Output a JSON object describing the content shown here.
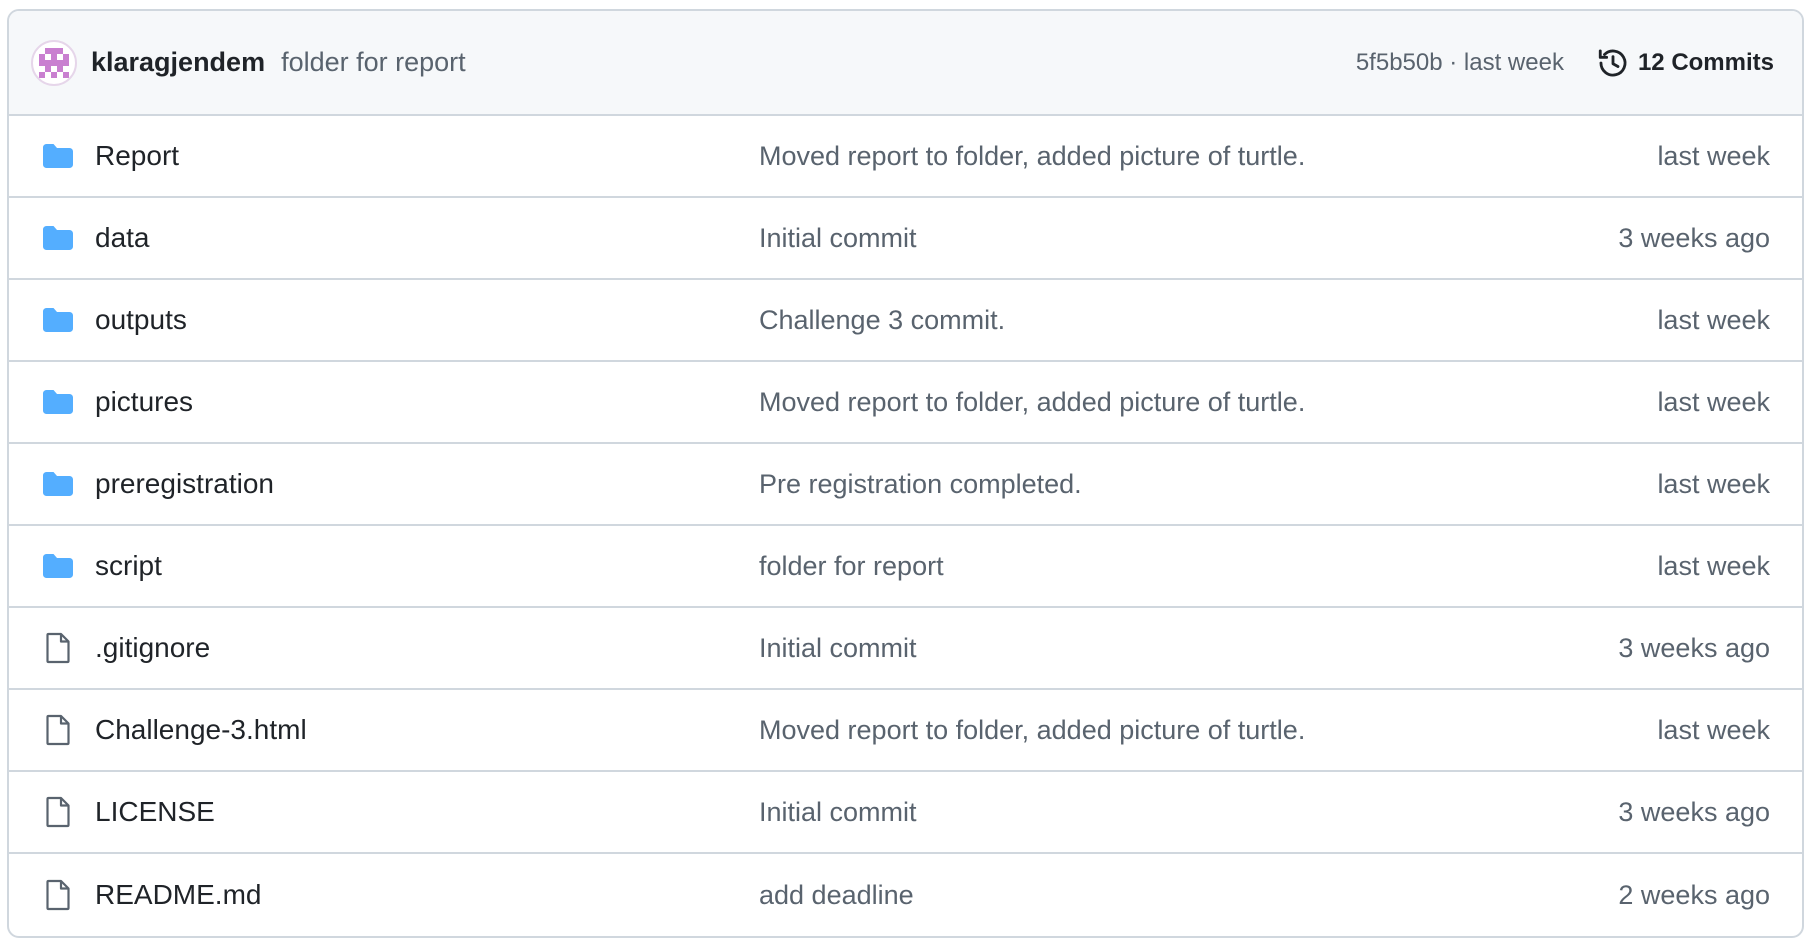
{
  "colors": {
    "folder": "#54aeff",
    "file_outline": "#59636e",
    "border": "#d0d7de",
    "header_bg": "#f6f8fa",
    "avatar_pink": "#c97fd0"
  },
  "latest_commit": {
    "author": "klaragjendem",
    "message": "folder for report",
    "meta": "5f5b50b · last week",
    "commits_label": "12 Commits",
    "avatar_icon": "identicon-avatar",
    "history_icon": "history-icon"
  },
  "files": [
    {
      "icon": "folder-icon",
      "name": "Report",
      "message": "Moved report to folder, added picture of turtle.",
      "date": "last week"
    },
    {
      "icon": "folder-icon",
      "name": "data",
      "message": "Initial commit",
      "date": "3 weeks ago"
    },
    {
      "icon": "folder-icon",
      "name": "outputs",
      "message": "Challenge 3 commit.",
      "date": "last week"
    },
    {
      "icon": "folder-icon",
      "name": "pictures",
      "message": "Moved report to folder, added picture of turtle.",
      "date": "last week"
    },
    {
      "icon": "folder-icon",
      "name": "preregistration",
      "message": "Pre registration completed.",
      "date": "last week"
    },
    {
      "icon": "folder-icon",
      "name": "script",
      "message": "folder for report",
      "date": "last week"
    },
    {
      "icon": "file-icon",
      "name": ".gitignore",
      "message": "Initial commit",
      "date": "3 weeks ago"
    },
    {
      "icon": "file-icon",
      "name": "Challenge-3.html",
      "message": "Moved report to folder, added picture of turtle.",
      "date": "last week"
    },
    {
      "icon": "file-icon",
      "name": "LICENSE",
      "message": "Initial commit",
      "date": "3 weeks ago"
    },
    {
      "icon": "file-icon",
      "name": "README.md",
      "message": "add deadline",
      "date": "2 weeks ago"
    }
  ]
}
